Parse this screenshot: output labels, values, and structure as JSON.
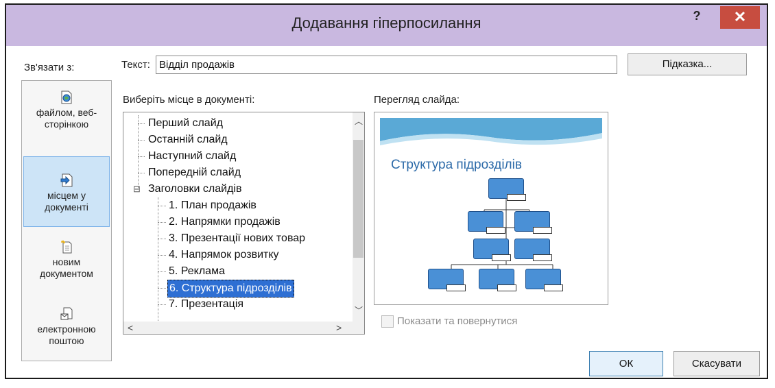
{
  "dialog": {
    "title": "Додавання гіперпосилання",
    "help_label": "?",
    "close_label": "✕"
  },
  "link_to": {
    "label": "Зв'язати з:",
    "items": [
      {
        "label": "файлом, веб-сторінкою",
        "icon": "web-file-icon"
      },
      {
        "label": "місцем у документі",
        "icon": "document-place-icon",
        "selected": true
      },
      {
        "label": "новим документом",
        "icon": "new-document-icon"
      },
      {
        "label": "електронною поштою",
        "icon": "email-icon"
      }
    ]
  },
  "text_field": {
    "label": "Текст:",
    "value": "Відділ продажів"
  },
  "tooltip_button": "Підказка...",
  "place": {
    "label": "Виберіть місце в документі:",
    "items": [
      {
        "label": "Перший слайд"
      },
      {
        "label": "Останній слайд"
      },
      {
        "label": "Наступний слайд"
      },
      {
        "label": "Попередній слайд"
      },
      {
        "label": "Заголовки слайдів",
        "expander": "⊟"
      },
      {
        "label": "1. План продажів"
      },
      {
        "label": "2. Напрямки продажів"
      },
      {
        "label": "3. Презентації нових товар"
      },
      {
        "label": "4. Напрямок розвитку"
      },
      {
        "label": "5. Реклама"
      },
      {
        "label": "6. Структура підрозділів",
        "selected": true
      },
      {
        "label": "7. Презентація"
      }
    ]
  },
  "preview": {
    "label": "Перегляд слайда:",
    "slide_title": "Структура  підрозділів"
  },
  "show_and_return": {
    "label": "Показати та повернутися",
    "checked": false
  },
  "buttons": {
    "ok": "ОК",
    "cancel": "Скасувати"
  },
  "colors": {
    "titlebar": "#c9b8e0",
    "close": "#c74d40",
    "selection": "#2e6fd3",
    "sidebar_selected": "#cde4f7",
    "slide_title": "#2c6aa8"
  }
}
